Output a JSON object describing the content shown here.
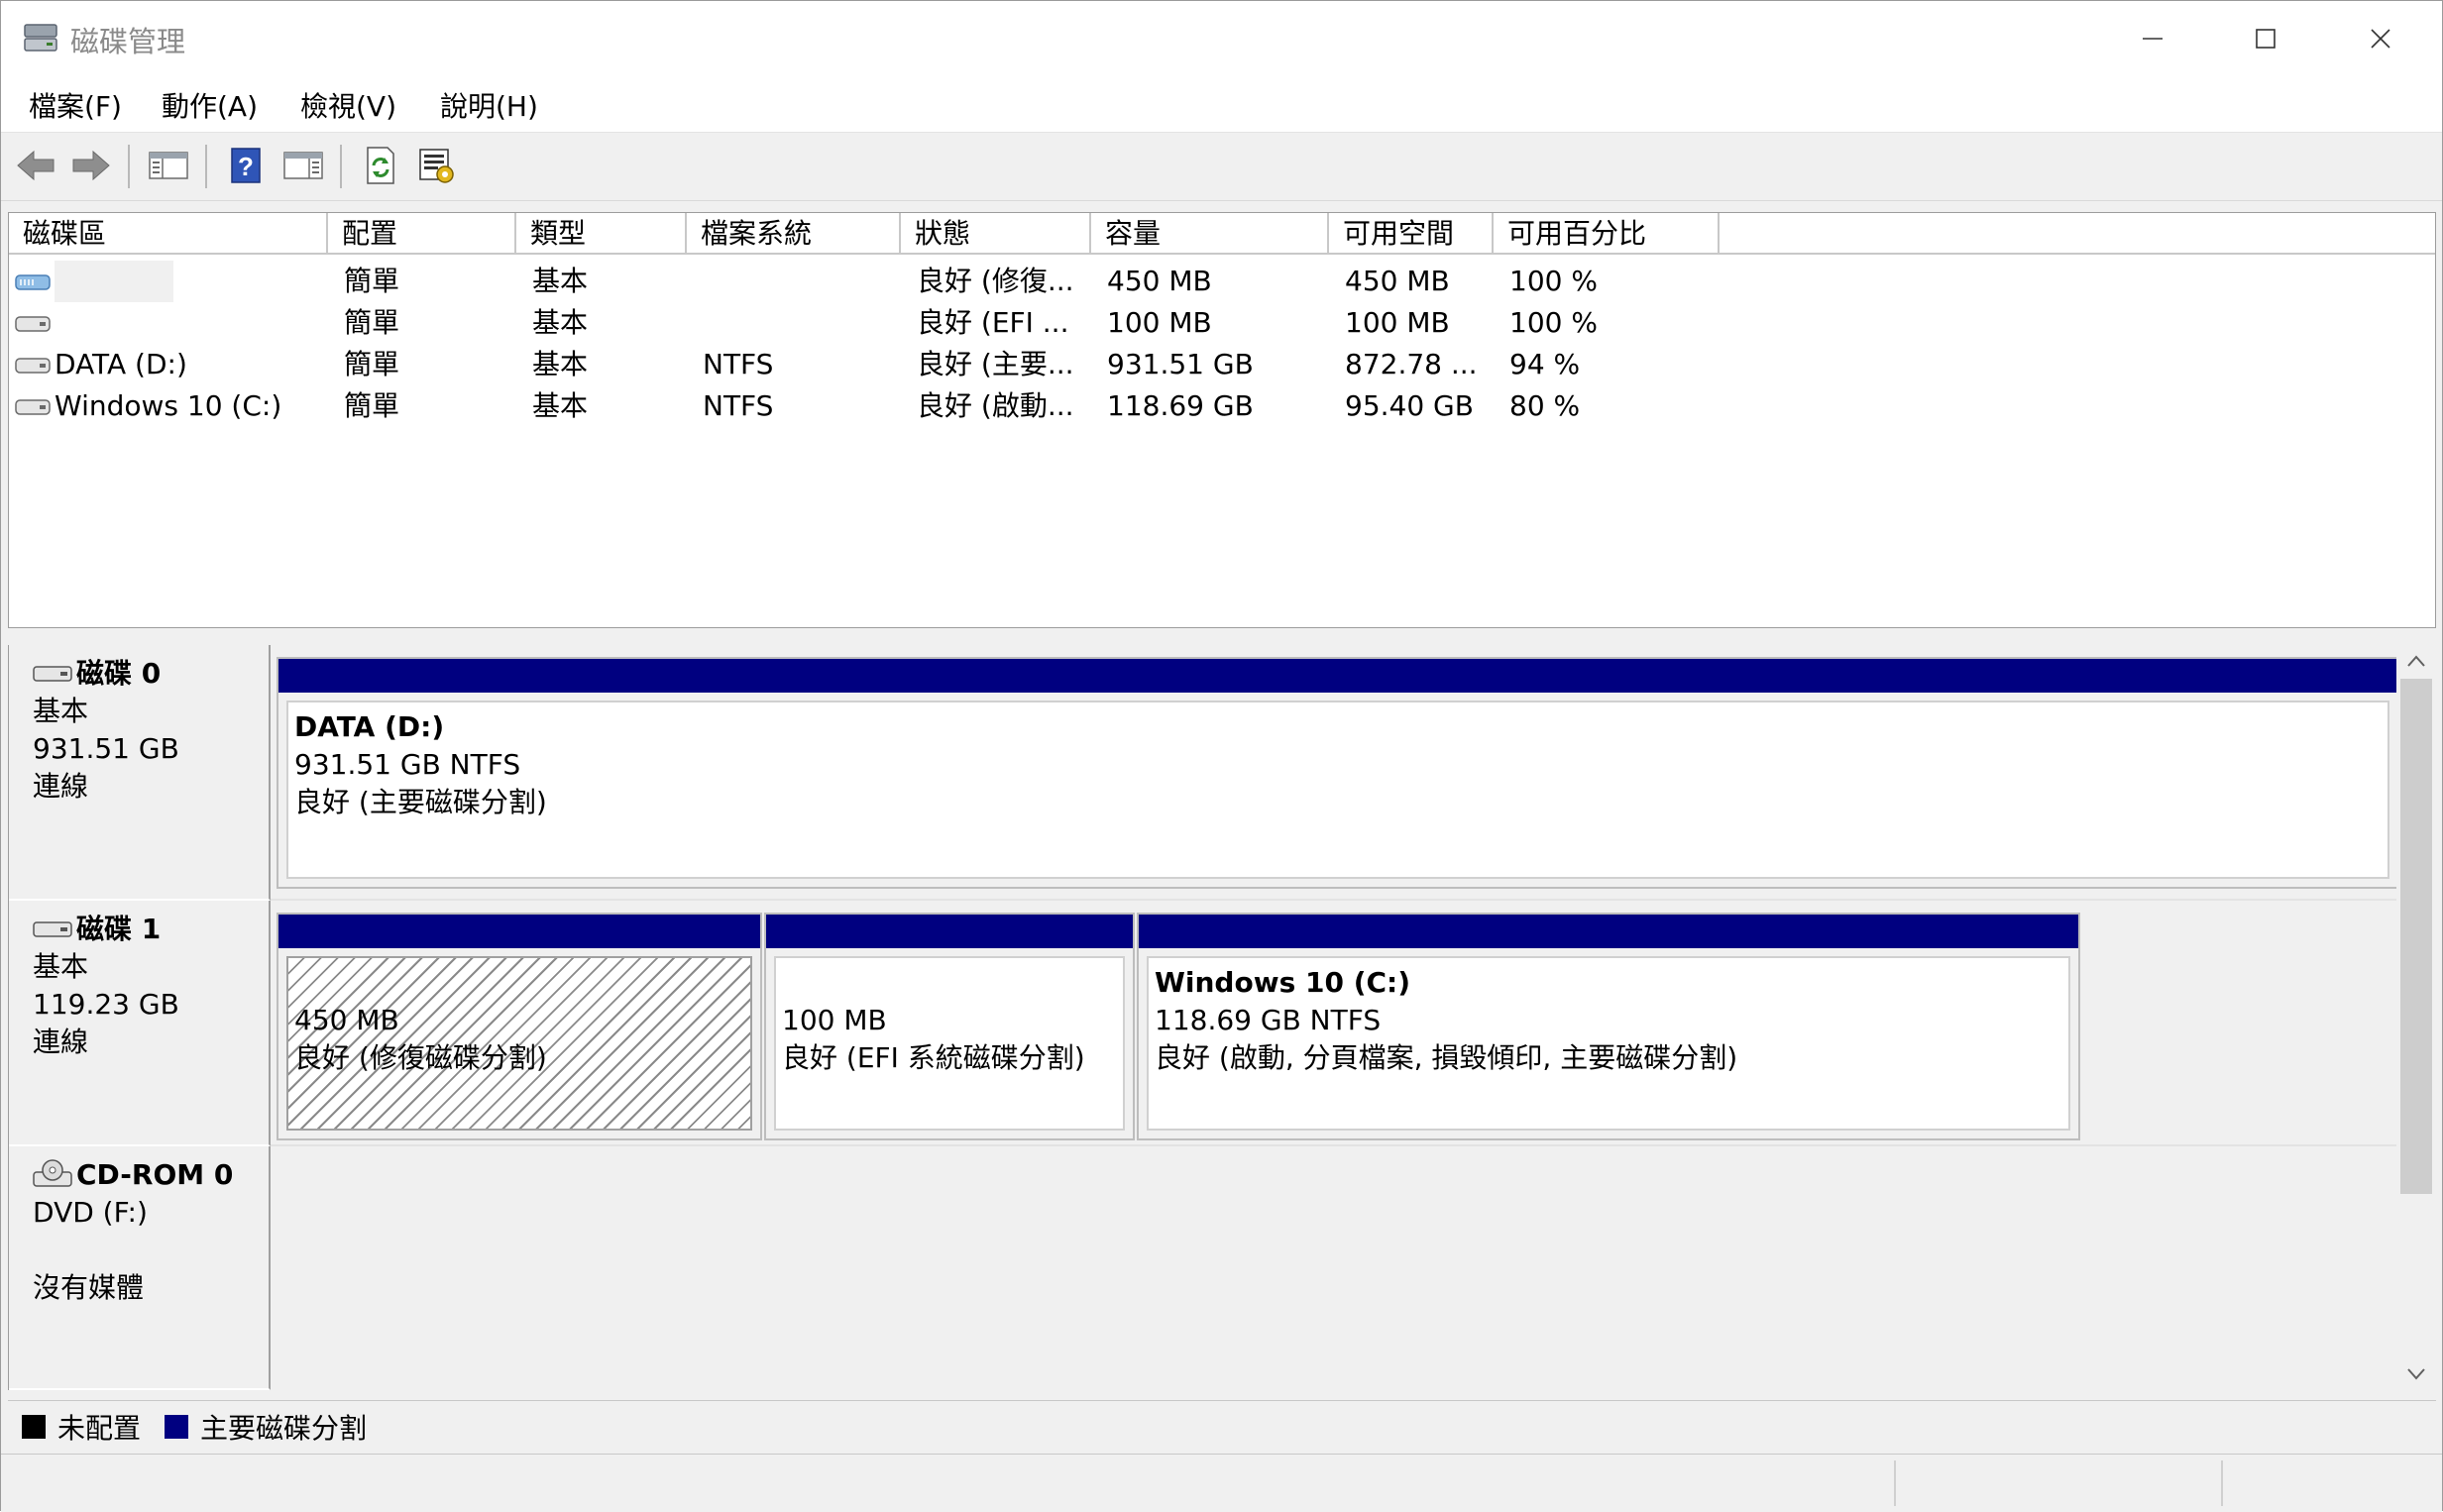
{
  "window": {
    "title": "磁碟管理",
    "icon": "disk-management-icon",
    "controls": [
      "minimize-icon",
      "maximize-icon",
      "close-icon"
    ]
  },
  "menu": {
    "file": "檔案(F)",
    "action": "動作(A)",
    "view": "檢視(V)",
    "help": "說明(H)"
  },
  "toolbar": {
    "icons": [
      "back-icon",
      "forward-icon",
      "show-hide-console-tree-icon",
      "help-icon",
      "show-hide-action-pane-icon",
      "refresh-icon",
      "properties-icon"
    ]
  },
  "volume_list": {
    "headers": [
      "磁碟區",
      "配置",
      "類型",
      "檔案系統",
      "狀態",
      "容量",
      "可用空間",
      "可用百分比"
    ],
    "rows": [
      {
        "volume": "",
        "layout": "簡單",
        "type": "基本",
        "fs": "",
        "status": "良好 (修復...",
        "capacity": "450 MB",
        "free": "450 MB",
        "pct": "100 %"
      },
      {
        "volume": "",
        "layout": "簡單",
        "type": "基本",
        "fs": "",
        "status": "良好 (EFI ...",
        "capacity": "100 MB",
        "free": "100 MB",
        "pct": "100 %"
      },
      {
        "volume": "DATA (D:)",
        "layout": "簡單",
        "type": "基本",
        "fs": "NTFS",
        "status": "良好 (主要...",
        "capacity": "931.51 GB",
        "free": "872.78 ...",
        "pct": "94 %"
      },
      {
        "volume": "Windows 10 (C:)",
        "layout": "簡單",
        "type": "基本",
        "fs": "NTFS",
        "status": "良好 (啟動...",
        "capacity": "118.69 GB",
        "free": "95.40 GB",
        "pct": "80 %"
      }
    ]
  },
  "disks": [
    {
      "name": "磁碟 0",
      "type": "基本",
      "size": "931.51 GB",
      "state": "連線",
      "partitions": [
        {
          "title": "DATA  (D:)",
          "line1": "931.51 GB NTFS",
          "line2": "良好 (主要磁碟分割)"
        }
      ]
    },
    {
      "name": "磁碟 1",
      "type": "基本",
      "size": "119.23 GB",
      "state": "連線",
      "partitions": [
        {
          "title": "",
          "line1": "450 MB",
          "line2": "良好 (修復磁碟分割)"
        },
        {
          "title": "",
          "line1": "100 MB",
          "line2": "良好 (EFI 系統磁碟分割)"
        },
        {
          "title": "Windows 10  (C:)",
          "line1": "118.69 GB NTFS",
          "line2": "良好 (啟動, 分頁檔案, 損毀傾印, 主要磁碟分割)"
        }
      ]
    },
    {
      "name": "CD-ROM 0",
      "type": "DVD (F:)",
      "size": "",
      "state": "沒有媒體"
    }
  ],
  "legend": {
    "unallocated": "未配置",
    "primary": "主要磁碟分割",
    "colors": {
      "unallocated": "#000000",
      "primary": "#000080"
    }
  }
}
